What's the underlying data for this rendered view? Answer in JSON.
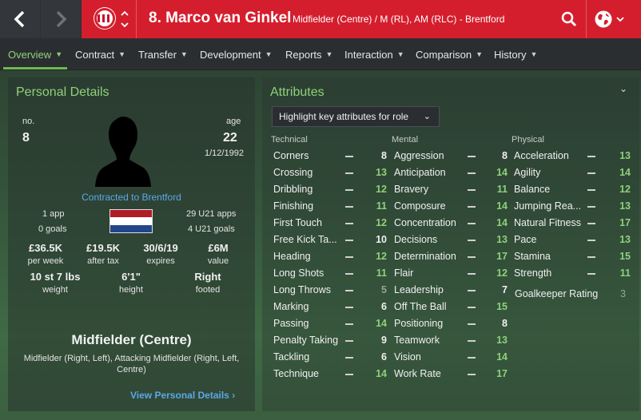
{
  "header": {
    "player_title": "8. Marco van Ginkel",
    "player_subtitle": "Midfielder (Centre) / M (RL), AM (RLC) - Brentford"
  },
  "tabs": [
    {
      "label": "Overview",
      "active": true
    },
    {
      "label": "Contract"
    },
    {
      "label": "Transfer"
    },
    {
      "label": "Development"
    },
    {
      "label": "Reports"
    },
    {
      "label": "Interaction"
    },
    {
      "label": "Comparison"
    },
    {
      "label": "History"
    }
  ],
  "personal": {
    "title": "Personal Details",
    "no_label": "no.",
    "no_value": "8",
    "age_label": "age",
    "age_value": "22",
    "dob": "1/12/1992",
    "contract": "Contracted to Brentford",
    "apps": "1 app",
    "goals": "0 goals",
    "u21_apps": "29 U21 apps",
    "u21_goals": "4 U21 goals",
    "stats": [
      {
        "value": "£36.5K",
        "label": "per week"
      },
      {
        "value": "£19.5K",
        "label": "after tax"
      },
      {
        "value": "30/6/19",
        "label": "expires"
      },
      {
        "value": "£6M",
        "label": "value"
      }
    ],
    "physical": [
      {
        "value": "10 st 7 lbs",
        "label": "weight"
      },
      {
        "value": "6'1\"",
        "label": "height"
      },
      {
        "value": "Right",
        "label": "footed"
      }
    ],
    "position_title": "Midfielder (Centre)",
    "position_sub": "Midfielder (Right, Left), Attacking Midfielder (Right, Left, Centre)",
    "view_link": "View Personal Details"
  },
  "attributes": {
    "title": "Attributes",
    "highlight_label": "Highlight key attributes for role",
    "categories": [
      "Technical",
      "Mental",
      "Physical"
    ],
    "technical": [
      {
        "name": "Corners",
        "value": "8",
        "color": "white"
      },
      {
        "name": "Crossing",
        "value": "13",
        "color": "green"
      },
      {
        "name": "Dribbling",
        "value": "12",
        "color": "green"
      },
      {
        "name": "Finishing",
        "value": "11",
        "color": "green"
      },
      {
        "name": "First Touch",
        "value": "12",
        "color": "green"
      },
      {
        "name": "Free Kick Ta...",
        "value": "10",
        "color": "white"
      },
      {
        "name": "Heading",
        "value": "12",
        "color": "green"
      },
      {
        "name": "Long Shots",
        "value": "11",
        "color": "green"
      },
      {
        "name": "Long Throws",
        "value": "5",
        "color": "grey"
      },
      {
        "name": "Marking",
        "value": "6",
        "color": "white"
      },
      {
        "name": "Passing",
        "value": "14",
        "color": "green"
      },
      {
        "name": "Penalty Taking",
        "value": "9",
        "color": "white"
      },
      {
        "name": "Tackling",
        "value": "6",
        "color": "white"
      },
      {
        "name": "Technique",
        "value": "14",
        "color": "green"
      }
    ],
    "mental": [
      {
        "name": "Aggression",
        "value": "8",
        "color": "white"
      },
      {
        "name": "Anticipation",
        "value": "14",
        "color": "green"
      },
      {
        "name": "Bravery",
        "value": "11",
        "color": "green"
      },
      {
        "name": "Composure",
        "value": "14",
        "color": "green"
      },
      {
        "name": "Concentration",
        "value": "14",
        "color": "green"
      },
      {
        "name": "Decisions",
        "value": "13",
        "color": "green"
      },
      {
        "name": "Determination",
        "value": "17",
        "color": "green"
      },
      {
        "name": "Flair",
        "value": "12",
        "color": "green"
      },
      {
        "name": "Leadership",
        "value": "7",
        "color": "white"
      },
      {
        "name": "Off The Ball",
        "value": "15",
        "color": "green"
      },
      {
        "name": "Positioning",
        "value": "8",
        "color": "white"
      },
      {
        "name": "Teamwork",
        "value": "13",
        "color": "green"
      },
      {
        "name": "Vision",
        "value": "14",
        "color": "green"
      },
      {
        "name": "Work Rate",
        "value": "17",
        "color": "green"
      }
    ],
    "physical": [
      {
        "name": "Acceleration",
        "value": "13",
        "color": "green"
      },
      {
        "name": "Agility",
        "value": "14",
        "color": "green"
      },
      {
        "name": "Balance",
        "value": "12",
        "color": "green"
      },
      {
        "name": "Jumping Rea...",
        "value": "13",
        "color": "green"
      },
      {
        "name": "Natural Fitness",
        "value": "17",
        "color": "green"
      },
      {
        "name": "Pace",
        "value": "13",
        "color": "green"
      },
      {
        "name": "Stamina",
        "value": "15",
        "color": "green"
      },
      {
        "name": "Strength",
        "value": "11",
        "color": "green"
      }
    ],
    "goalkeeper": {
      "name": "Goalkeeper Rating",
      "value": "3"
    }
  },
  "colors": {
    "header_red": "#d51e2d",
    "accent_green": "#8fd17a",
    "link_blue": "#5aa8e8"
  }
}
